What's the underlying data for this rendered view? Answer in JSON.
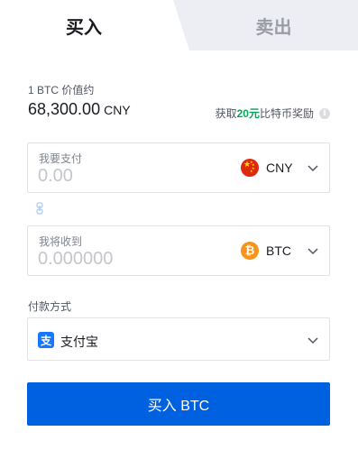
{
  "tabs": {
    "buy": "买入",
    "sell": "卖出"
  },
  "price": {
    "label": "1 BTC 价值约",
    "value": "68,300.00",
    "unit": "CNY"
  },
  "reward": {
    "prefix": "获取",
    "amount": "20元",
    "suffix": "比特币奖励"
  },
  "pay": {
    "label": "我要支付",
    "placeholder": "0.00",
    "currency": "CNY",
    "icon": "china-flag-icon"
  },
  "receive": {
    "label": "我将收到",
    "placeholder": "0.000000",
    "currency": "BTC",
    "icon": "bitcoin-icon"
  },
  "payment_method": {
    "label": "付款方式",
    "selected": "支付宝",
    "icon": "alipay-icon",
    "icon_glyph": "支"
  },
  "submit_label": "买入 BTC",
  "colors": {
    "accent": "#0061e0",
    "reward_green": "#0aa35c",
    "sell_tab_bg": "#eceef3",
    "btc_orange": "#f7931a",
    "cny_red": "#de2910",
    "alipay_blue": "#1677ff"
  }
}
